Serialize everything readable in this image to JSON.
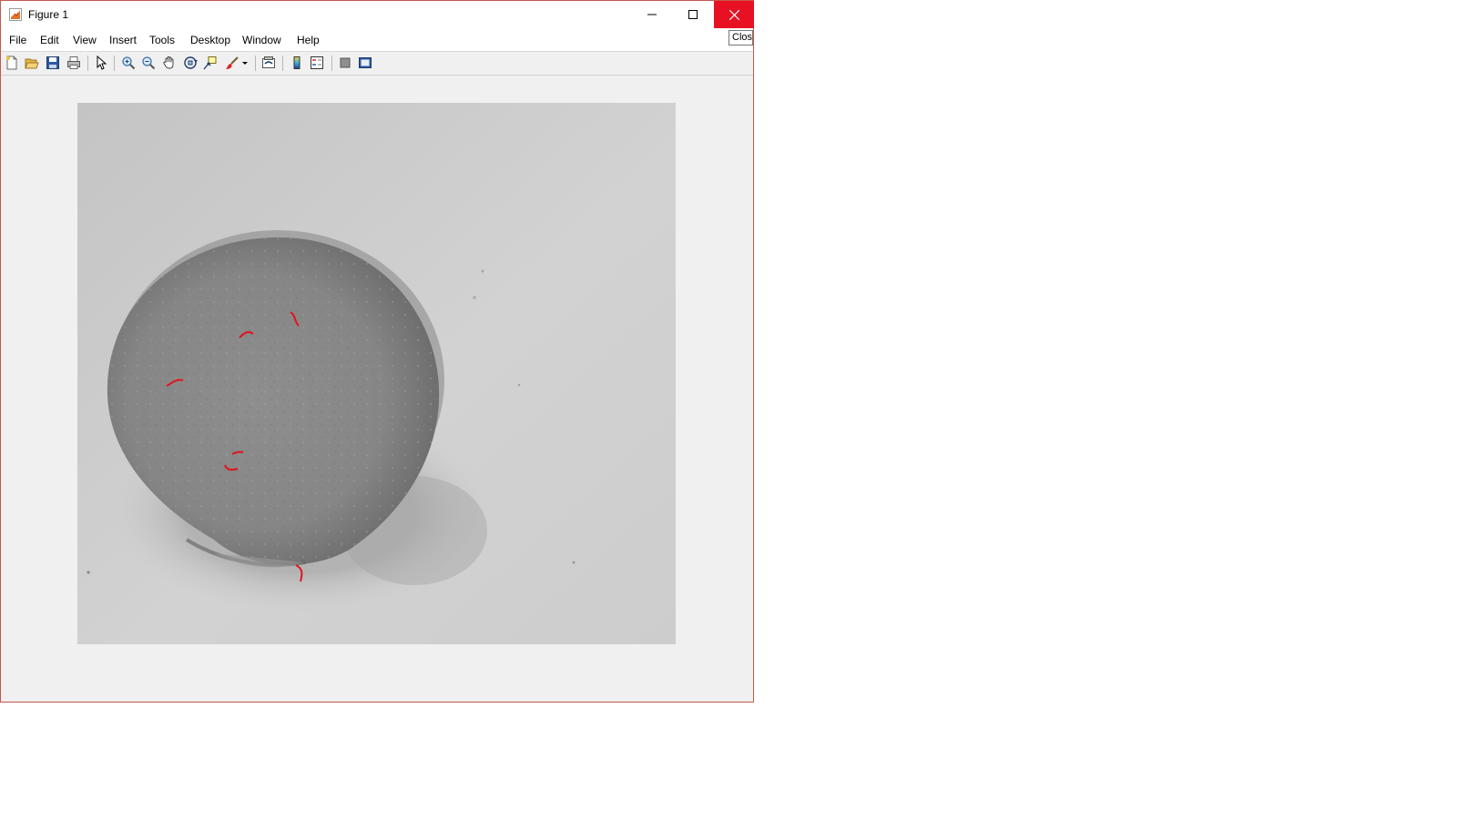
{
  "window": {
    "title": "Figure 1",
    "close_color": "#e81123",
    "border_color": "#c2594f"
  },
  "menu": {
    "file": "File",
    "edit": "Edit",
    "view": "View",
    "insert": "Insert",
    "tools": "Tools",
    "desktop": "Desktop",
    "window": "Window",
    "help": "Help"
  },
  "toolbar": {
    "icons": [
      "new-figure-icon",
      "open-file-icon",
      "save-icon",
      "print-icon",
      "edit-plot-icon",
      "zoom-in-icon",
      "zoom-out-icon",
      "pan-icon",
      "rotate-3d-icon",
      "data-cursor-icon",
      "brush-icon",
      "link-plot-icon",
      "insert-colorbar-icon",
      "insert-legend-icon",
      "hide-plot-tools-icon",
      "show-plot-tools-icon"
    ]
  },
  "tooltip": {
    "text": "Close"
  },
  "figure": {
    "image": "grayscale-microscopy-sphere",
    "overlay_color": "#e0141e",
    "overlay_marks": 6
  }
}
